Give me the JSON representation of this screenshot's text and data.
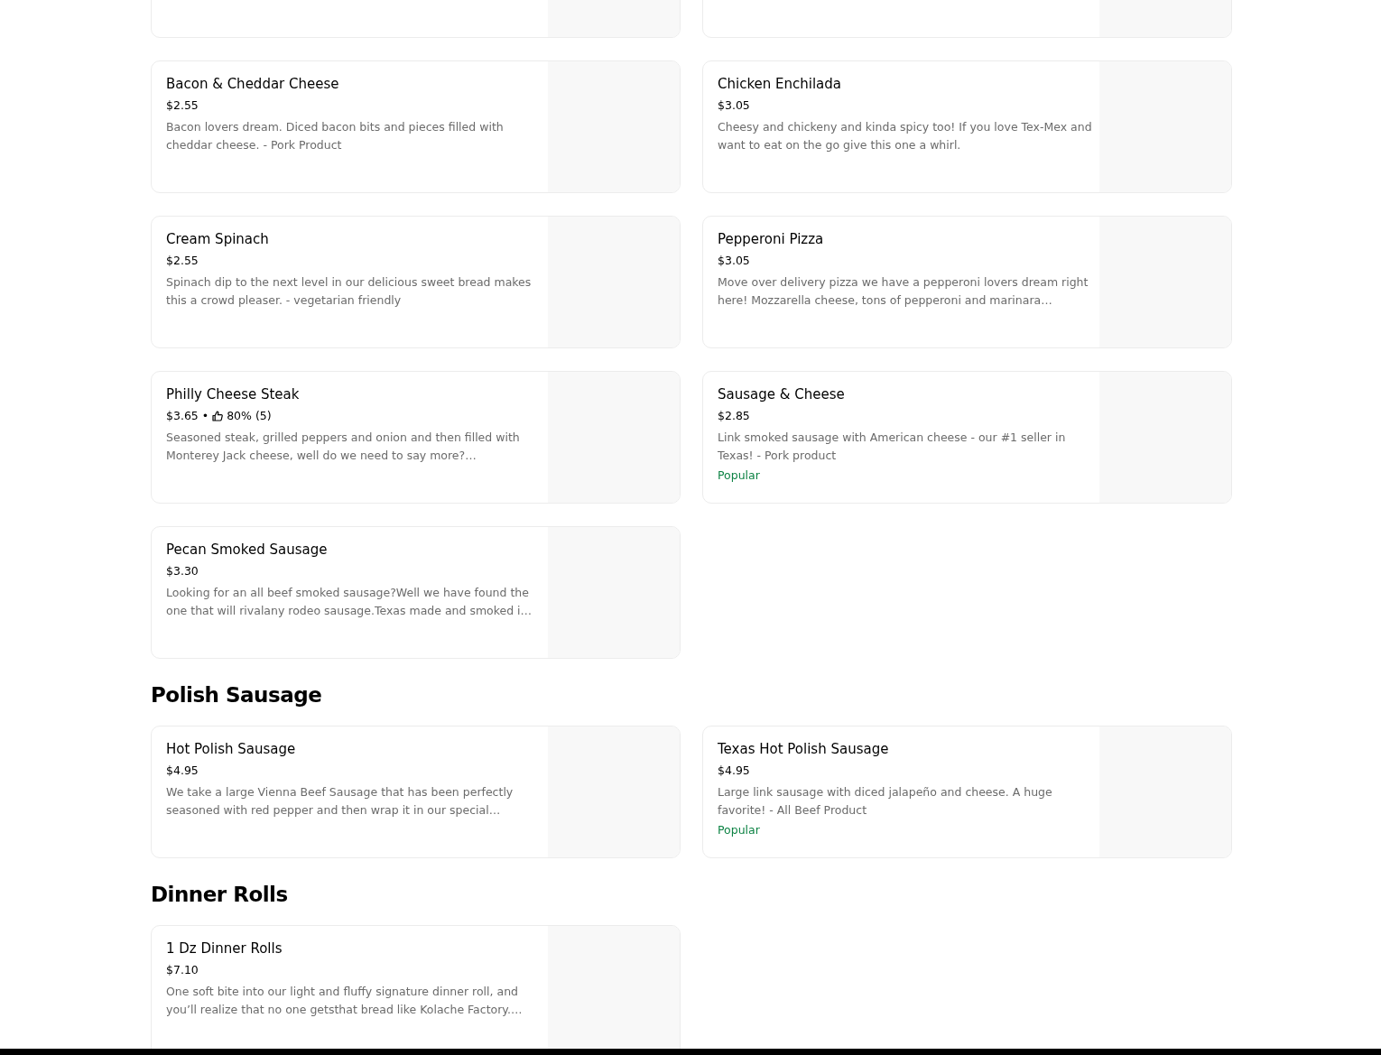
{
  "sections": [
    {
      "items": [
        {
          "name": "Bacon & Cheddar Cheese",
          "price": "$2.55",
          "description": "Bacon lovers dream. Diced bacon bits and pieces filled with cheddar cheese. - Pork Product"
        },
        {
          "name": "Chicken Enchilada",
          "price": "$3.05",
          "description": "Cheesy and chickeny and kinda spicy too! If you love Tex-Mex and want to eat on the go give this one a whirl."
        },
        {
          "name": "Cream Spinach",
          "price": "$2.55",
          "description": "Spinach dip to the next level in our delicious sweet bread makes this a crowd pleaser. - vegetarian friendly"
        },
        {
          "name": "Pepperoni Pizza",
          "price": "$3.05",
          "description": "Move over delivery pizza we have a pepperoni lovers dream right here! Mozzarella cheese, tons of pepperoni and marinara…"
        },
        {
          "name": "Philly Cheese Steak",
          "price": "$3.65",
          "separator": "•",
          "rating": "80% (5)",
          "description": "Seasoned steak, grilled peppers and onion and then filled with Monterey Jack cheese, well do we need to say more?…"
        },
        {
          "name": "Sausage & Cheese",
          "price": "$2.85",
          "description": "Link smoked sausage with American cheese - our #1 seller in Texas! - Pork product",
          "tag": "Popular"
        },
        {
          "name": "Pecan Smoked Sausage",
          "price": "$3.30",
          "description": "Looking for an all beef smoked sausage?Well we have found the one that will rivalany rodeo sausage.Texas made and smoked i…"
        }
      ]
    },
    {
      "title": "Polish Sausage",
      "items": [
        {
          "name": "Hot Polish Sausage",
          "price": "$4.95",
          "description": "We take a large Vienna Beef Sausage that has been perfectly seasoned with red pepper and then wrap it in our special…"
        },
        {
          "name": "Texas Hot Polish Sausage",
          "price": "$4.95",
          "description": "Large link sausage with diced jalapeño and cheese. A huge favorite! - All Beef Product",
          "tag": "Popular"
        }
      ]
    },
    {
      "title": "Dinner Rolls",
      "items": [
        {
          "name": "1 Dz Dinner Rolls",
          "price": "$7.10",
          "description": "One soft bite into our light and fluffy signature dinner roll, and you’ll realize that no one getsthat bread like Kolache Factory.…"
        }
      ]
    }
  ]
}
